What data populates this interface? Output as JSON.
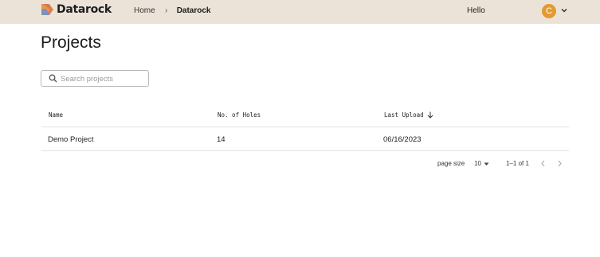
{
  "header": {
    "logo_text": "Datarock",
    "breadcrumb": {
      "home": "Home",
      "separator": "›",
      "current": "Datarock"
    },
    "greeting": "Hello",
    "avatar_initial": "C"
  },
  "page": {
    "title": "Projects",
    "search": {
      "placeholder": "Search projects",
      "value": ""
    }
  },
  "table": {
    "columns": [
      "Name",
      "No. of Holes",
      "Last Upload"
    ],
    "sort": {
      "column": "Last Upload",
      "direction": "descending"
    },
    "rows": [
      {
        "name": "Demo Project",
        "holes": "14",
        "last_upload": "06/16/2023"
      }
    ]
  },
  "pagination": {
    "page_size_label": "page size",
    "page_size": "10",
    "range": "1–1 of 1"
  },
  "colors": {
    "header_bg": "#ece3d8",
    "avatar_bg": "#e39a30",
    "logo_orange": "#e9944e",
    "logo_blue": "#6a92c9"
  },
  "icons": [
    "datarock-logo-icon",
    "breadcrumb-chevron-icon",
    "chevron-down-icon",
    "search-icon",
    "arrow-down-icon",
    "caret-down-icon",
    "chevron-left-icon",
    "chevron-right-icon"
  ]
}
